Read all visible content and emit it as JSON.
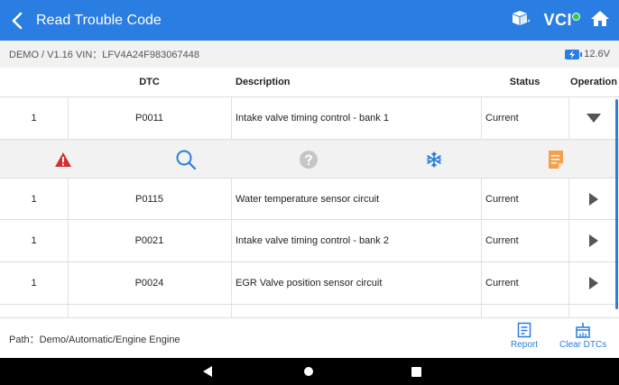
{
  "header": {
    "title": "Read Trouble Code",
    "vci_label": "VCI"
  },
  "info": {
    "demo_version_vin": "DEMO / V1.16  VIN：LFV4A24F983067448",
    "battery_voltage": "12.6V"
  },
  "table": {
    "columns": [
      "",
      "DTC",
      "Description",
      "Status",
      "Operation"
    ],
    "rows": [
      {
        "index": "1",
        "dtc": "P0011",
        "description": "Intake valve timing control - bank 1",
        "status": "Current",
        "expanded": true
      },
      {
        "index": "1",
        "dtc": "P0115",
        "description": "Water temperature sensor circuit",
        "status": "Current",
        "expanded": false
      },
      {
        "index": "1",
        "dtc": "P0021",
        "description": "Intake valve timing control - bank 2",
        "status": "Current",
        "expanded": false
      },
      {
        "index": "1",
        "dtc": "P0024",
        "description": "EGR Valve position sensor circuit",
        "status": "Current",
        "expanded": false
      }
    ]
  },
  "expanded_actions": [
    "warning-icon",
    "search-icon",
    "help-icon",
    "freeze-frame-icon",
    "report-doc-icon"
  ],
  "footer": {
    "path": "Path：Demo/Automatic/Engine Engine",
    "report_label": "Report",
    "clear_label": "Clear DTCs"
  },
  "colors": {
    "primary": "#2a7de1",
    "warning": "#d32f2f",
    "orange": "#f5a04a",
    "vci_dot": "#35c94b"
  }
}
